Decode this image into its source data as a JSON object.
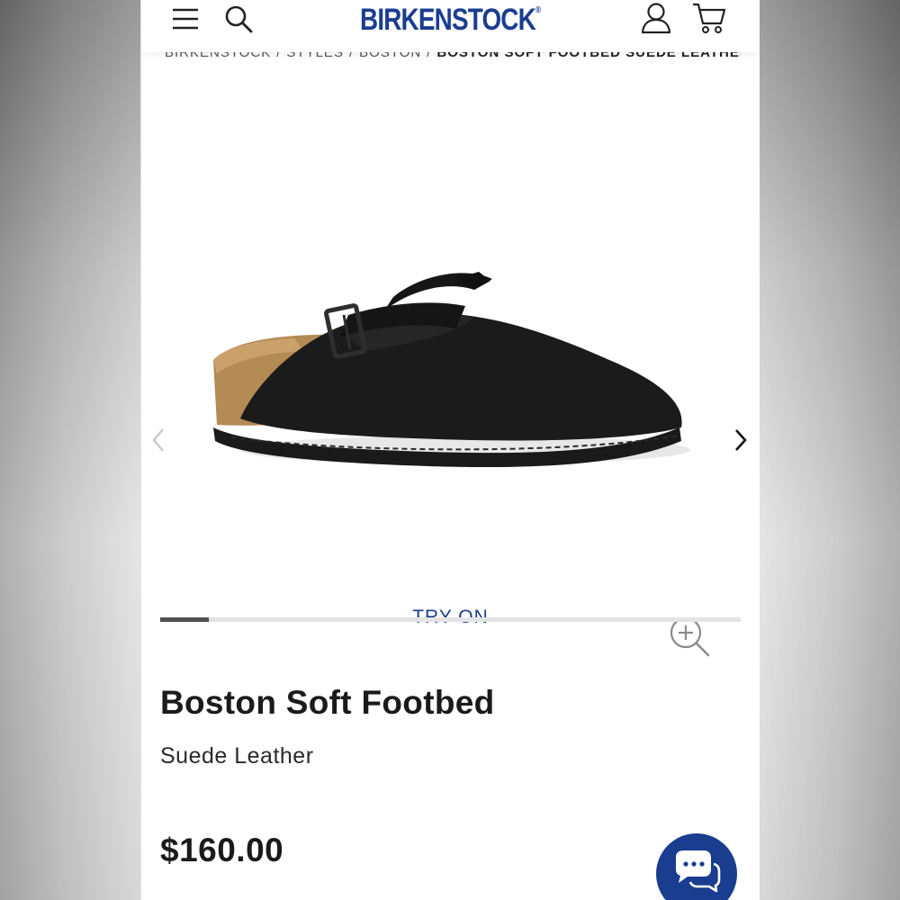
{
  "header": {
    "logo_text": "BIRKENSTOCK",
    "logo_mark": "®",
    "icons": [
      "menu-icon",
      "search-icon",
      "account-icon",
      "cart-icon"
    ],
    "brand_color": "#1a3d8f"
  },
  "breadcrumb": {
    "items": [
      "BIRKENSTOCK",
      "STYLES",
      "BOSTON"
    ],
    "current": "BOSTON SOFT FOOTBED SUEDE LEATHER",
    "separator": "/"
  },
  "gallery": {
    "try_on_label": "TRY ON",
    "progress_fraction": 0.083,
    "icons": [
      "chevron-left-icon",
      "chevron-right-icon",
      "zoom-in-icon"
    ]
  },
  "product": {
    "title": "Boston Soft Footbed",
    "subtitle": "Suede Leather",
    "price": "$160.00"
  },
  "chat": {
    "icon": "chat-bubbles-icon",
    "color": "#1a3d8f"
  }
}
